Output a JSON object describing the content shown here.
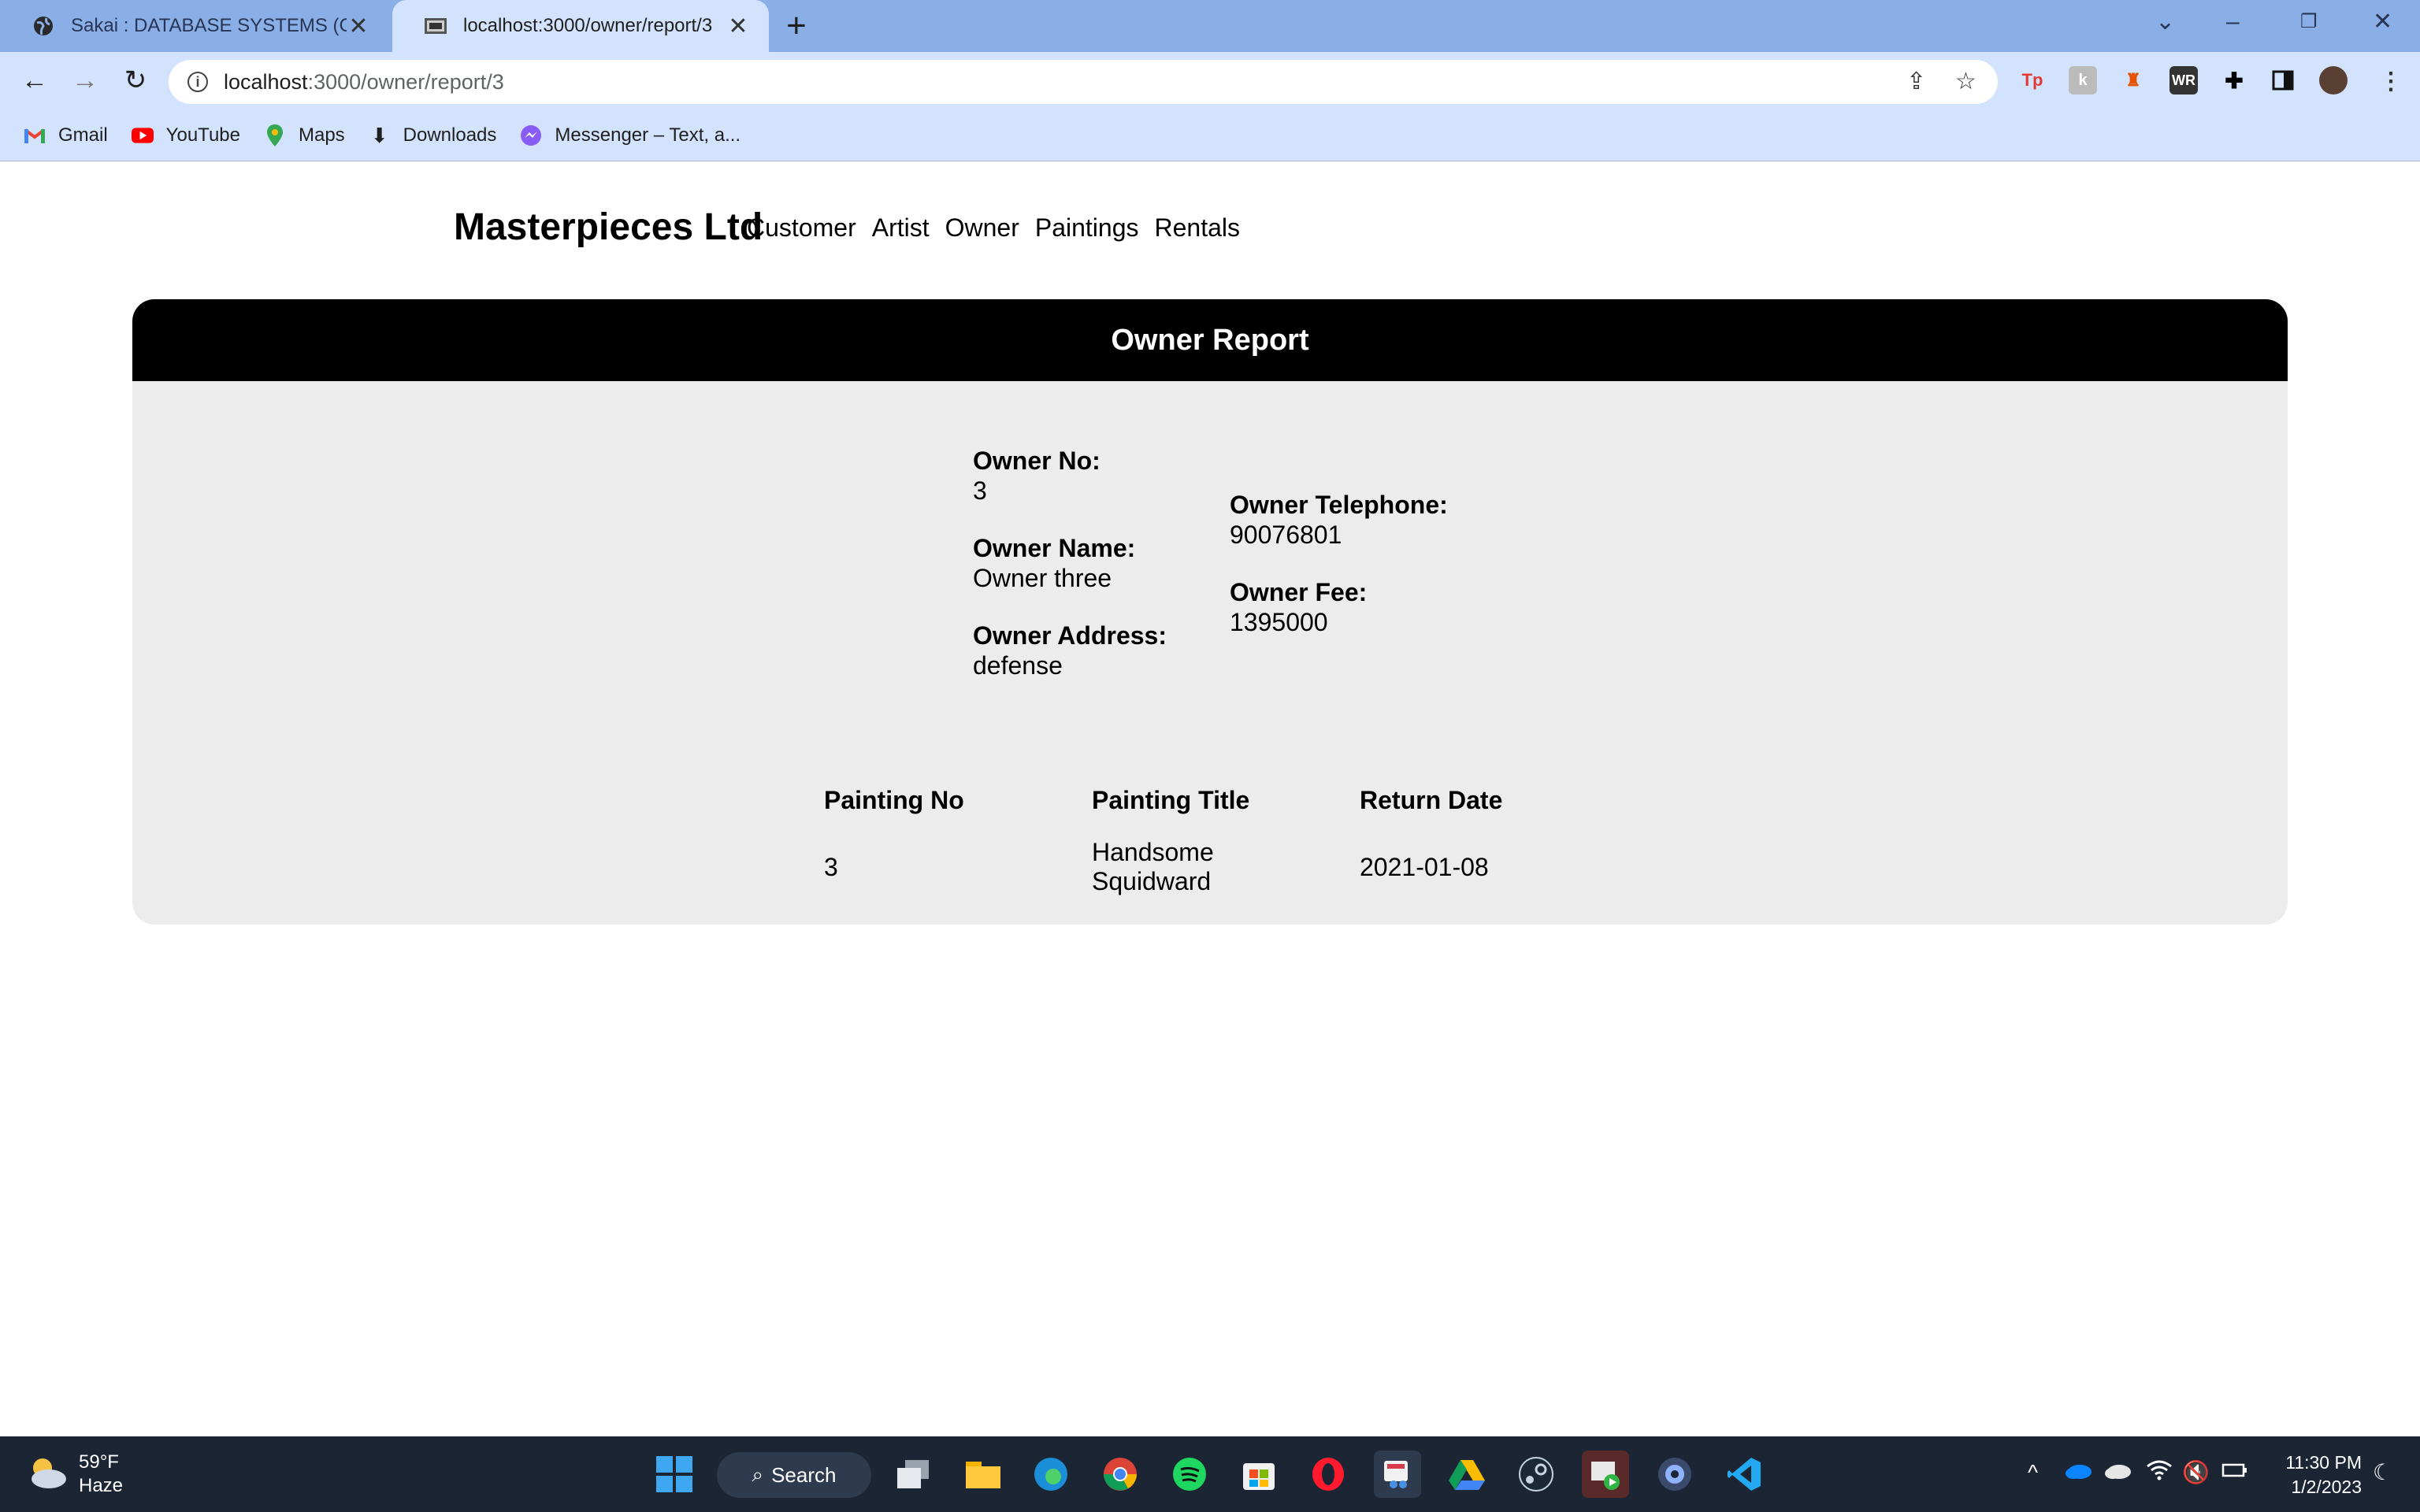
{
  "browser": {
    "tabs": [
      {
        "title": "Sakai : DATABASE SYSTEMS (Clas",
        "active": false
      },
      {
        "title": "localhost:3000/owner/report/3",
        "active": true
      }
    ],
    "new_tab_symbol": "+",
    "url_host": "localhost",
    "url_path": ":3000/owner/report/3",
    "bookmarks": [
      {
        "label": "Gmail",
        "icon": "gmail-icon"
      },
      {
        "label": "YouTube",
        "icon": "youtube-icon"
      },
      {
        "label": "Maps",
        "icon": "maps-icon"
      },
      {
        "label": "Downloads",
        "icon": "download-icon"
      },
      {
        "label": "Messenger – Text, a...",
        "icon": "messenger-icon"
      }
    ],
    "extensions": [
      "Tp",
      "WR"
    ]
  },
  "site": {
    "brand": "Masterpieces Ltd",
    "nav": [
      "Customer",
      "Artist",
      "Owner",
      "Paintings",
      "Rentals"
    ]
  },
  "report": {
    "heading": "Owner Report",
    "owner_no_label": "Owner No:",
    "owner_no": "3",
    "owner_name_label": "Owner Name:",
    "owner_name": "Owner three",
    "owner_address_label": "Owner Address:",
    "owner_address": "defense",
    "owner_telephone_label": "Owner Telephone:",
    "owner_telephone": "90076801",
    "owner_fee_label": "Owner Fee:",
    "owner_fee": "1395000",
    "table": {
      "headers": [
        "Painting No",
        "Painting Title",
        "Return Date"
      ],
      "rows": [
        {
          "painting_no": "3",
          "title_line1": "Handsome",
          "title_line2": "Squidward",
          "return_date": "2021-01-08"
        }
      ]
    }
  },
  "taskbar": {
    "weather_temp": "59°F",
    "weather_desc": "Haze",
    "search_label": "Search",
    "time": "11:30 PM",
    "date": "1/2/2023"
  }
}
